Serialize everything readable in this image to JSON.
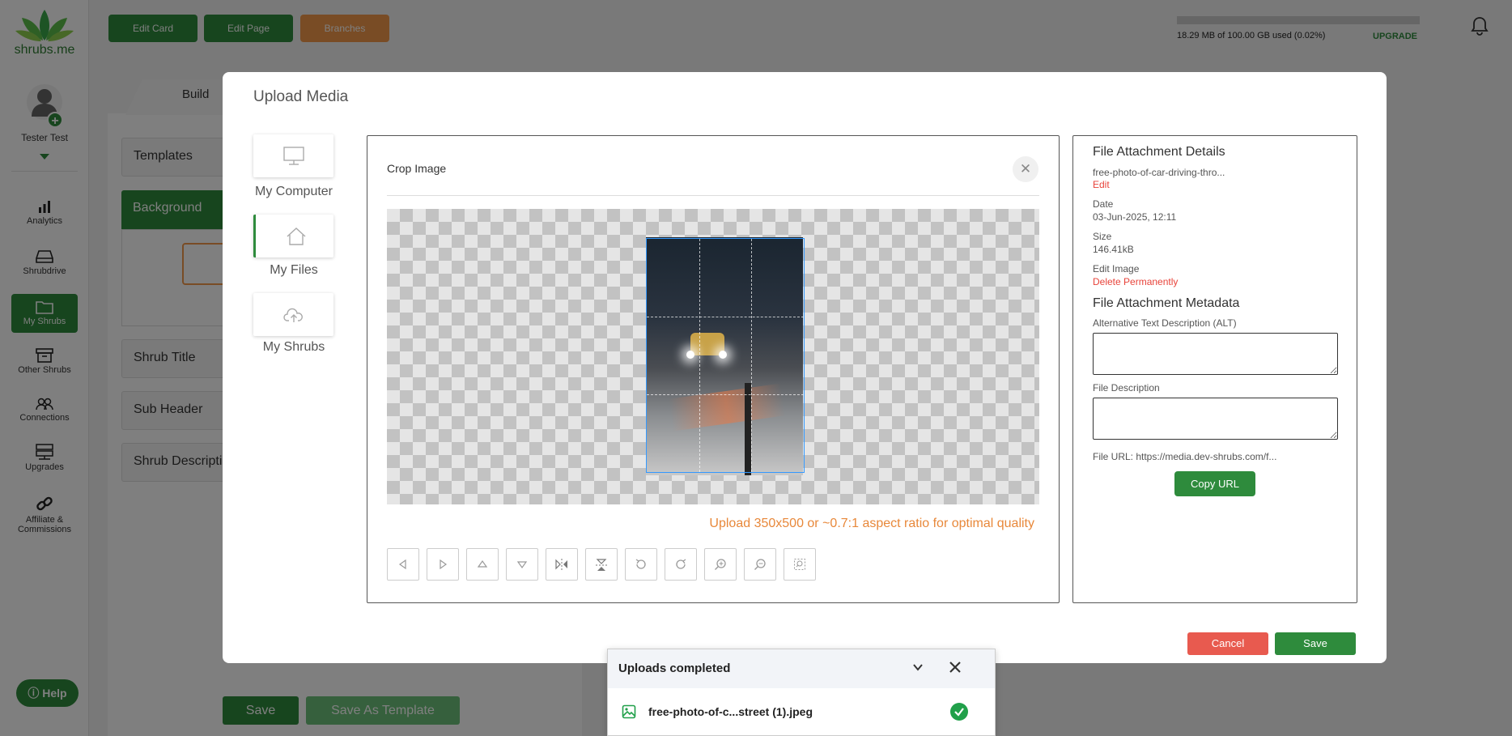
{
  "brand": {
    "name": "shrubs.me",
    "color": "#2e8b3c"
  },
  "user": {
    "name": "Tester Test"
  },
  "sidebar": {
    "items": [
      {
        "label": "Analytics",
        "icon": "bar-chart-icon"
      },
      {
        "label": "Shrubdrive",
        "icon": "drive-icon"
      },
      {
        "label": "My Shrubs",
        "icon": "folder-icon",
        "active": true
      },
      {
        "label": "Other Shrubs",
        "icon": "archive-icon"
      },
      {
        "label": "Connections",
        "icon": "users-icon"
      },
      {
        "label": "Upgrades",
        "icon": "server-icon"
      },
      {
        "label": "Affiliate & Commissions",
        "icon": "link-icon"
      }
    ],
    "help_label": "Help"
  },
  "topbar": {
    "edit_card": "Edit Card",
    "edit_page": "Edit Page",
    "branches": "Branches",
    "storage_text": "18.29 MB of 100.00 GB used (0.02%)",
    "upgrade": "UPGRADE"
  },
  "background_page": {
    "build_tab": "Build",
    "templates": "Templates",
    "background": "Background",
    "shrub_title": "Shrub Title",
    "sub_header": "Sub Header",
    "shrub_description": "Shrub Descripti",
    "save": "Save",
    "save_as_template": "Save As Template"
  },
  "modal": {
    "title": "Upload Media",
    "sources": [
      {
        "label": "My Computer",
        "icon": "monitor-icon"
      },
      {
        "label": "My Files",
        "icon": "home-icon",
        "active": true
      },
      {
        "label": "My Shrubs",
        "icon": "cloud-upload-icon"
      }
    ],
    "crop": {
      "title": "Crop Image",
      "hint": "Upload 350x500 or ~0.7:1 aspect ratio for optimal quality",
      "tools": [
        "move-left-icon",
        "move-right-icon",
        "move-up-icon",
        "move-down-icon",
        "flip-horizontal-icon",
        "flip-vertical-icon",
        "rotate-left-icon",
        "rotate-right-icon",
        "zoom-in-icon",
        "zoom-out-icon",
        "crop-reset-icon"
      ]
    },
    "details": {
      "heading": "File Attachment Details",
      "file_name": "free-photo-of-car-driving-thro...",
      "edit": "Edit",
      "date_label": "Date",
      "date_value": "03-Jun-2025, 12:11",
      "size_label": "Size",
      "size_value": "146.41kB",
      "edit_image": "Edit Image",
      "delete": "Delete Permanently",
      "metadata_heading": "File Attachment Metadata",
      "alt_label": "Alternative Text Description (ALT)",
      "alt_value": "",
      "desc_label": "File Description",
      "desc_value": "",
      "file_url": "File URL: https://media.dev-shrubs.com/f...",
      "copy_url": "Copy URL"
    },
    "cancel": "Cancel",
    "save": "Save"
  },
  "toast": {
    "title": "Uploads completed",
    "file": "free-photo-of-c...street (1).jpeg"
  }
}
